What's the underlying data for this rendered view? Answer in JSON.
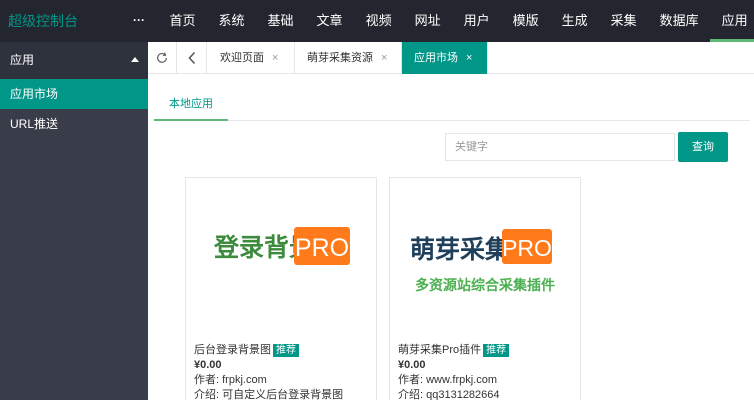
{
  "app": {
    "logo": "超级控制台",
    "more": "···"
  },
  "nav": [
    "首页",
    "系统",
    "基础",
    "文章",
    "视频",
    "网址",
    "用户",
    "模版",
    "生成",
    "采集",
    "数据库",
    "应用"
  ],
  "sidebar": {
    "header": "应用",
    "items": [
      {
        "label": "应用市场"
      },
      {
        "label": "URL推送"
      }
    ]
  },
  "tabs": [
    {
      "label": "欢迎页面",
      "close": "×"
    },
    {
      "label": "萌芽采集资源",
      "close": "×"
    },
    {
      "label": "应用市场",
      "close": "×"
    }
  ],
  "subtabs": [
    "本地应用"
  ],
  "search": {
    "placeholder": "关键字",
    "button": "查询"
  },
  "cards": [
    {
      "banner_text": "登录背景",
      "banner_pro": "PRO",
      "name": "后台登录背景图",
      "badge": "推荐",
      "price": "¥0.00",
      "author": "作者: frpkj.com",
      "desc": "介绍: 可自定义后台登录背景图"
    },
    {
      "banner_text": "萌芽采集",
      "banner_pro": "PRO",
      "banner_sub": "多资源站综合采集插件",
      "name": "萌芽采集Pro插件",
      "badge": "推荐",
      "price": "¥0.00",
      "author": "作者: www.frpkj.com",
      "desc": "介绍: qq3131282664"
    }
  ],
  "colors": {
    "accent": "#009688",
    "topbar": "#23262e",
    "sidebar": "#393d49",
    "orange": "#ff7a1a",
    "banner_green": "#3d8b3d",
    "banner_dark": "#1f3f5a"
  }
}
